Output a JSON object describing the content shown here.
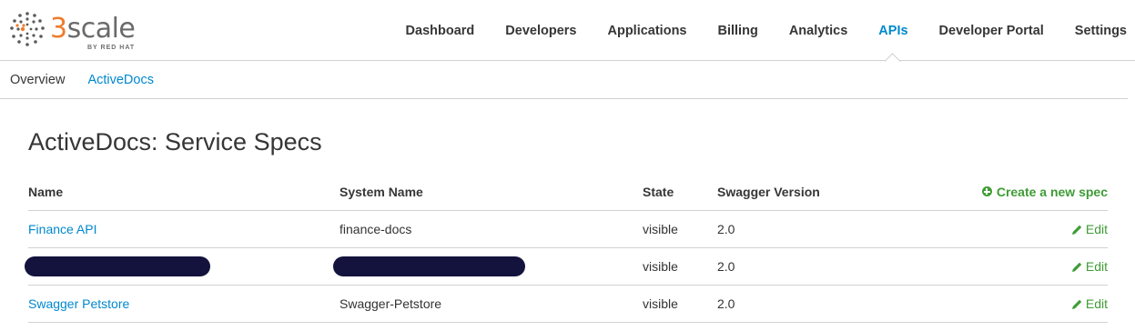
{
  "brand": {
    "number": "3",
    "word": "scale",
    "tagline": "BY RED HAT",
    "accent": "#ee7c2e"
  },
  "nav": {
    "items": [
      {
        "label": "Dashboard"
      },
      {
        "label": "Developers"
      },
      {
        "label": "Applications"
      },
      {
        "label": "Billing"
      },
      {
        "label": "Analytics"
      },
      {
        "label": "APIs",
        "active": true
      },
      {
        "label": "Developer Portal"
      },
      {
        "label": "Settings"
      }
    ],
    "active_color": "#0088ce"
  },
  "subnav": {
    "overview": "Overview",
    "activedocs": "ActiveDocs"
  },
  "page": {
    "title": "ActiveDocs: Service Specs"
  },
  "table": {
    "headers": {
      "name": "Name",
      "system_name": "System Name",
      "state": "State",
      "swagger_version": "Swagger Version"
    },
    "create_label": "Create a new spec",
    "rows": [
      {
        "name": "Finance API",
        "system_name": "finance-docs",
        "state": "visible",
        "swagger_version": "2.0",
        "action": "Edit"
      },
      {
        "name": "",
        "system_name": "",
        "state": "visible",
        "swagger_version": "2.0",
        "action": "Edit",
        "redacted": true
      },
      {
        "name": "Swagger Petstore",
        "system_name": "Swagger-Petstore",
        "state": "visible",
        "swagger_version": "2.0",
        "action": "Edit"
      }
    ]
  },
  "colors": {
    "link": "#0088ce",
    "success": "#3f9c35",
    "redaction": "#13133d"
  }
}
